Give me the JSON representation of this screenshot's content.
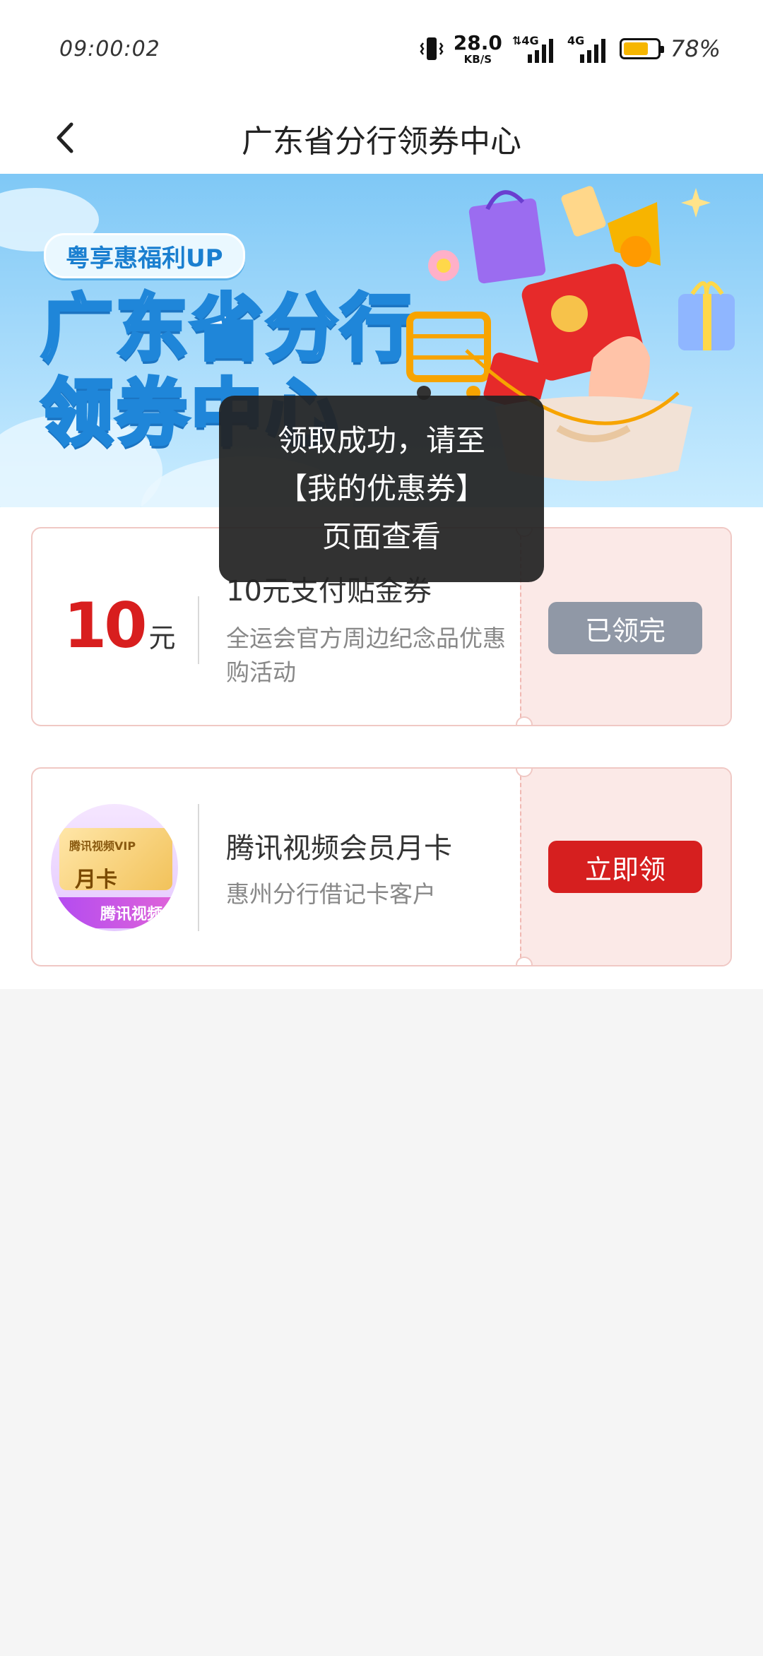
{
  "status_bar": {
    "time": "09:00:02",
    "net_speed": "28.0",
    "net_unit": "KB/S",
    "signal1": "4G",
    "signal2": "4G",
    "battery_percent": "78%",
    "battery_level": 0.78
  },
  "nav": {
    "title": "广东省分行领券中心",
    "back_icon": "chevron-left-icon"
  },
  "banner": {
    "badge": "粤享惠福利UP",
    "title_line1": "广东省分行",
    "title_line2": "领券中心"
  },
  "coupons": [
    {
      "amount": "10",
      "unit": "元",
      "title": "10元支付贴金券",
      "desc": "全运会官方周边纪念品优惠购活动",
      "button": "已领完"
    },
    {
      "thumb_brand": "腾讯视频VIP",
      "thumb_label": "月卡",
      "thumb_strip": "腾讯视频",
      "title": "腾讯视频会员月卡",
      "desc": "惠州分行借记卡客户",
      "button": "立即领"
    }
  ],
  "toast": {
    "line1": "领取成功，请至",
    "line2": "【我的优惠券】",
    "line3": "页面查看"
  },
  "colors": {
    "accent_red": "#d61f1f",
    "disabled_gray": "#9098a6",
    "coupon_bg": "#fbe9e7"
  }
}
